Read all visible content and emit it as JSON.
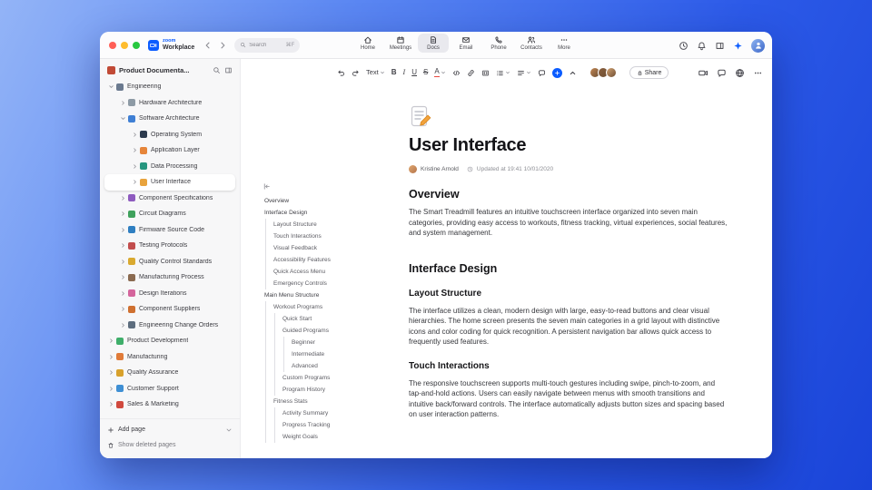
{
  "accent": "#0b5cff",
  "titlebar": {
    "traffic_lights": [
      {
        "name": "close-button",
        "color": "#ff5f57"
      },
      {
        "name": "minimize-button",
        "color": "#febc2e"
      },
      {
        "name": "zoom-button",
        "color": "#28c840"
      }
    ],
    "brand_line1": "zoom",
    "brand_line2": "Workplace",
    "search_placeholder": "Search",
    "search_shortcut": "⌘F",
    "tabs": [
      {
        "label": "Home",
        "icon": "home"
      },
      {
        "label": "Meetings",
        "icon": "calendar"
      },
      {
        "label": "Docs",
        "icon": "doc",
        "active": true
      },
      {
        "label": "Email",
        "icon": "mail"
      },
      {
        "label": "Phone",
        "icon": "phone"
      },
      {
        "label": "Contacts",
        "icon": "contacts"
      },
      {
        "label": "More",
        "icon": "more"
      }
    ],
    "actions": [
      {
        "name": "history-button",
        "icon": "clock"
      },
      {
        "name": "notifications-button",
        "icon": "bell"
      },
      {
        "name": "side-panel-button",
        "icon": "panel"
      },
      {
        "name": "ai-companion-button",
        "icon": "sparkle",
        "blue": true
      }
    ]
  },
  "sidebar": {
    "title": "Product Documenta...",
    "title_icon_color": "#c14a36",
    "tree": [
      {
        "label": "Engineering",
        "level": 0,
        "expanded": true,
        "color": "#6b7a8f"
      },
      {
        "label": "Hardware Architecture",
        "level": 1,
        "color": "#8d9aa5"
      },
      {
        "label": "Software Architecture",
        "level": 1,
        "expanded": true,
        "color": "#3f7fd4"
      },
      {
        "label": "Operating System",
        "level": 2,
        "color": "#2c3a4e"
      },
      {
        "label": "Application Layer",
        "level": 2,
        "color": "#e6853a"
      },
      {
        "label": "Data Processing",
        "level": 2,
        "color": "#27967f"
      },
      {
        "label": "User Interface",
        "level": 2,
        "selected": true,
        "color": "#e8a33d"
      },
      {
        "label": "Component Specifications",
        "level": 1,
        "color": "#8e5bbf"
      },
      {
        "label": "Circuit Diagrams",
        "level": 1,
        "color": "#3fa15c"
      },
      {
        "label": "Firmware Source Code",
        "level": 1,
        "color": "#2f7fc1"
      },
      {
        "label": "Testing Protocols",
        "level": 1,
        "color": "#c24d4d"
      },
      {
        "label": "Quality Control Standards",
        "level": 1,
        "color": "#d9a92f"
      },
      {
        "label": "Manufacturing Process",
        "level": 1,
        "color": "#8a6a50"
      },
      {
        "label": "Design Iterations",
        "level": 1,
        "color": "#d4659c"
      },
      {
        "label": "Component Suppliers",
        "level": 1,
        "color": "#cf7030"
      },
      {
        "label": "Engineering Change Orders",
        "level": 1,
        "color": "#5d6d7e"
      },
      {
        "label": "Product Development",
        "level": 0,
        "color": "#3fae6a"
      },
      {
        "label": "Manufacturing",
        "level": 0,
        "color": "#e07b39"
      },
      {
        "label": "Quality Assurance",
        "level": 0,
        "color": "#d8a12c"
      },
      {
        "label": "Customer Support",
        "level": 0,
        "color": "#3f8fd4"
      },
      {
        "label": "Sales & Marketing",
        "level": 0,
        "color": "#d0493e"
      }
    ],
    "add_page_label": "Add page",
    "show_deleted_label": "Show deleted pages"
  },
  "editor_toolbar": {
    "items": [
      {
        "name": "undo-button",
        "icon": "undo"
      },
      {
        "name": "redo-button",
        "icon": "redo"
      },
      {
        "name": "text-style-dropdown",
        "text": "Text",
        "tcls": "style-label",
        "caret": true
      },
      {
        "name": "bold-button",
        "text": "B",
        "tcls": "tb-b"
      },
      {
        "name": "italic-button",
        "text": "I",
        "tcls": "tb-i"
      },
      {
        "name": "underline-button",
        "text": "U",
        "tcls": "tb-u"
      },
      {
        "name": "strikethrough-button",
        "text": "S",
        "tcls": "tb-s"
      },
      {
        "name": "text-color-dropdown",
        "text": "A",
        "tcls": "tb-a",
        "caret": true
      },
      {
        "name": "inline-code-button",
        "icon": "code"
      },
      {
        "name": "link-button",
        "icon": "link"
      },
      {
        "name": "code-block-button",
        "icon": "codeblock"
      },
      {
        "name": "list-dropdown",
        "icon": "list",
        "caret": true
      },
      {
        "name": "align-dropdown",
        "icon": "align",
        "caret": true
      },
      {
        "name": "comment-button",
        "icon": "comment"
      },
      {
        "name": "insert-button",
        "icon": "plus",
        "cls": "plus-blue"
      },
      {
        "name": "collapse-toolbar-button",
        "icon": "chevron-up"
      }
    ],
    "collaborator_colors": [
      "#c08552",
      "#8a5f3d",
      "#d4a373"
    ],
    "share_label": "Share",
    "right_actions": [
      {
        "name": "start-video-button",
        "icon": "camera"
      },
      {
        "name": "open-comments-button",
        "icon": "comment"
      },
      {
        "name": "publish-to-web-button",
        "icon": "globe"
      },
      {
        "name": "more-options-button",
        "icon": "more"
      }
    ]
  },
  "outline": {
    "items": [
      {
        "label": "Overview",
        "level": 0
      },
      {
        "label": "Interface Design",
        "level": 0
      },
      {
        "label": "Layout Structure",
        "level": 1
      },
      {
        "label": "Touch Interactions",
        "level": 1
      },
      {
        "label": "Visual Feedback",
        "level": 1
      },
      {
        "label": "Accessibility Features",
        "level": 1
      },
      {
        "label": "Quick Access Menu",
        "level": 1
      },
      {
        "label": "Emergency Controls",
        "level": 1
      },
      {
        "label": "Main Menu Structure",
        "level": 0
      },
      {
        "label": "Workout Programs",
        "level": 1
      },
      {
        "label": "Quick Start",
        "level": 2
      },
      {
        "label": "Guided Programs",
        "level": 2
      },
      {
        "label": "Beginner",
        "level": 3
      },
      {
        "label": "Intermediate",
        "level": 3
      },
      {
        "label": "Advanced",
        "level": 3
      },
      {
        "label": "Custom Programs",
        "level": 2
      },
      {
        "label": "Program History",
        "level": 2
      },
      {
        "label": "Fitness Stats",
        "level": 1
      },
      {
        "label": "Activity Summary",
        "level": 2
      },
      {
        "label": "Progress Tracking",
        "level": 2
      },
      {
        "label": "Weight Goals",
        "level": 2
      }
    ]
  },
  "doc": {
    "title": "User Interface",
    "author": "Kristine Arnold",
    "updated": "Updated at 19:41 10/01/2020",
    "sections": [
      {
        "type": "h2",
        "text": "Overview"
      },
      {
        "type": "p",
        "text": "The Smart Treadmill features an intuitive touchscreen interface organized into seven main categories, providing easy access to workouts, fitness tracking, virtual experiences, social features, and system management."
      },
      {
        "type": "h2",
        "text": "Interface Design"
      },
      {
        "type": "h3",
        "text": "Layout Structure"
      },
      {
        "type": "p",
        "text": "The interface utilizes a clean, modern design with large, easy-to-read buttons and clear visual hierarchies. The home screen presents the seven main categories in a grid layout with distinctive icons and color coding for quick recognition. A persistent navigation bar allows quick access to frequently used features."
      },
      {
        "type": "h3",
        "text": "Touch Interactions"
      },
      {
        "type": "p",
        "text": "The responsive touchscreen supports multi-touch gestures including swipe, pinch-to-zoom, and tap-and-hold actions. Users can easily navigate between menus with smooth transitions and intuitive back/forward controls. The interface automatically adjusts button sizes and spacing based on user interaction patterns."
      }
    ]
  }
}
